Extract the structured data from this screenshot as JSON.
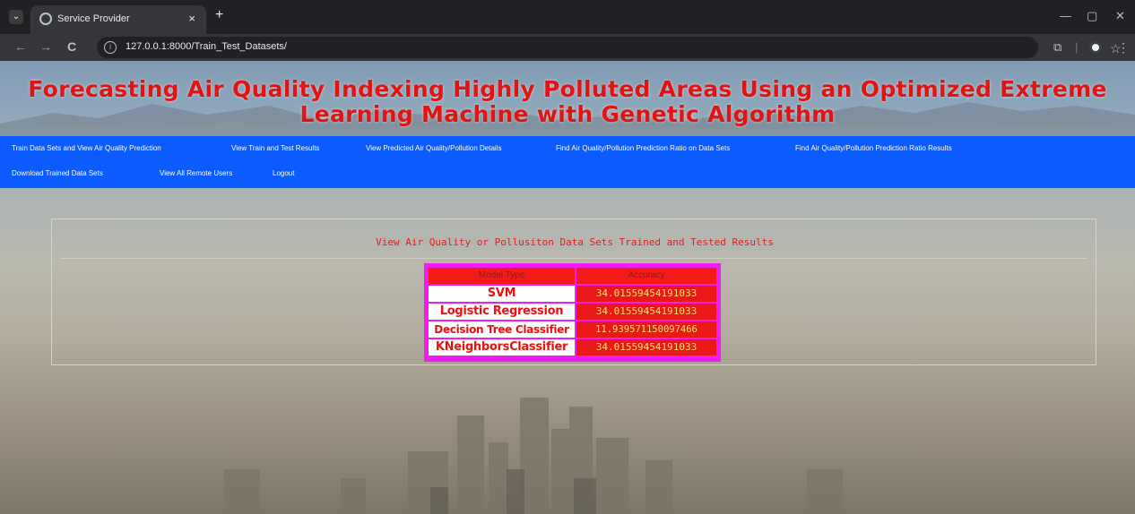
{
  "browser": {
    "tab_title": "Service Provider",
    "tab_close": "×",
    "new_tab": "+",
    "menu_glyph": "⌄",
    "url": "127.0.0.1:8000/Train_Test_Datasets/",
    "window_controls": {
      "minimize": "—",
      "restore": "▢",
      "close": "✕"
    },
    "nav": {
      "back": "←",
      "forward": "→",
      "reload": "C"
    },
    "icons": {
      "star": "☆",
      "extensions": "⧉",
      "separator": "|",
      "menu": "⋮"
    }
  },
  "site": {
    "title": "Forecasting Air Quality Indexing Highly Polluted Areas Using an Optimized Extreme Learning Machine with Genetic Algorithm",
    "title_color": "#e11313"
  },
  "menu": {
    "items": [
      "Train Data Sets and View Air Quality Prediction",
      "View Train and Test Results",
      "View Predicted Air Quality/Pollution Details",
      "Find Air Quality/Pollution Prediction Ratio on Data Sets",
      "Find Air Quality/Pollution Prediction Ratio Results",
      "Download Trained Data Sets",
      "View All Remote Users",
      "Logout"
    ],
    "bar_color": "#0b5bff"
  },
  "panel": {
    "heading": "View Air Quality or Pollusiton Data Sets Trained and Tested Results"
  },
  "results_table": {
    "headers": [
      "Model Type",
      "Accuracy"
    ],
    "rows": [
      {
        "model": "SVM",
        "accuracy": "34.01559454191033"
      },
      {
        "model": "Logistic Regression",
        "accuracy": "34.01559454191033"
      },
      {
        "model": "Decision Tree Classifier",
        "accuracy": "11.939571150097466"
      },
      {
        "model": "KNeighborsClassifier",
        "accuracy": "34.01559454191033"
      }
    ],
    "border_color": "#ee1fee",
    "cell_color": "#ea1818"
  }
}
